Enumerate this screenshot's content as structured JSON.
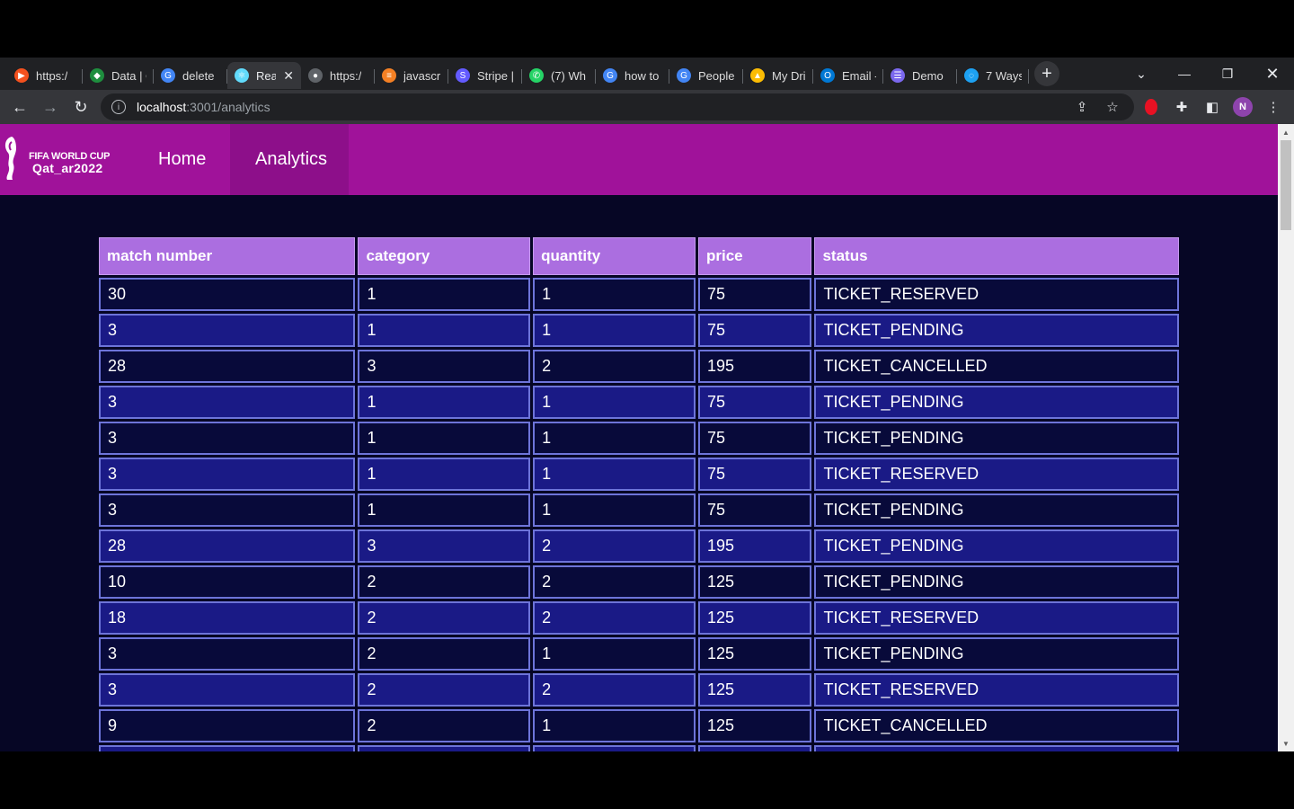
{
  "browser": {
    "tabs": [
      {
        "title": "https:/",
        "color": "#f4511e",
        "glyph": "▶"
      },
      {
        "title": "Data | C",
        "color": "#1e8e3e",
        "glyph": "◆"
      },
      {
        "title": "delete",
        "color": "#4285f4",
        "glyph": "G"
      },
      {
        "title": "Rea",
        "color": "#61dafb",
        "glyph": "⚛",
        "active": true
      },
      {
        "title": "https:/",
        "color": "#5f6368",
        "glyph": "●"
      },
      {
        "title": "javascr",
        "color": "#f48024",
        "glyph": "≡"
      },
      {
        "title": "Stripe |",
        "color": "#635bff",
        "glyph": "S"
      },
      {
        "title": "(7) Wh",
        "color": "#25d366",
        "glyph": "✆"
      },
      {
        "title": "how to",
        "color": "#4285f4",
        "glyph": "G"
      },
      {
        "title": "People",
        "color": "#4285f4",
        "glyph": "G"
      },
      {
        "title": "My Dri",
        "color": "#fbbc04",
        "glyph": "▲"
      },
      {
        "title": "Email -",
        "color": "#0078d4",
        "glyph": "O"
      },
      {
        "title": "Demo",
        "color": "#7b68ee",
        "glyph": "☰"
      },
      {
        "title": "7 Ways",
        "color": "#1da1f2",
        "glyph": "◌"
      }
    ],
    "address": {
      "host": "localhost",
      "path": ":3001/analytics"
    },
    "profile_initial": "N"
  },
  "app": {
    "logo": {
      "line1": "FIFA WORLD CUP",
      "line2": "Qat_ar2022"
    },
    "nav": {
      "home": "Home",
      "analytics": "Analytics"
    }
  },
  "table": {
    "columns": [
      "match number",
      "category",
      "quantity",
      "price",
      "status"
    ],
    "rows": [
      [
        "30",
        "1",
        "1",
        "75",
        "TICKET_RESERVED"
      ],
      [
        "3",
        "1",
        "1",
        "75",
        "TICKET_PENDING"
      ],
      [
        "28",
        "3",
        "2",
        "195",
        "TICKET_CANCELLED"
      ],
      [
        "3",
        "1",
        "1",
        "75",
        "TICKET_PENDING"
      ],
      [
        "3",
        "1",
        "1",
        "75",
        "TICKET_PENDING"
      ],
      [
        "3",
        "1",
        "1",
        "75",
        "TICKET_RESERVED"
      ],
      [
        "3",
        "1",
        "1",
        "75",
        "TICKET_PENDING"
      ],
      [
        "28",
        "3",
        "2",
        "195",
        "TICKET_PENDING"
      ],
      [
        "10",
        "2",
        "2",
        "125",
        "TICKET_PENDING"
      ],
      [
        "18",
        "2",
        "2",
        "125",
        "TICKET_RESERVED"
      ],
      [
        "3",
        "2",
        "1",
        "125",
        "TICKET_PENDING"
      ],
      [
        "3",
        "2",
        "2",
        "125",
        "TICKET_RESERVED"
      ],
      [
        "9",
        "2",
        "1",
        "125",
        "TICKET_CANCELLED"
      ],
      [
        "",
        "",
        "",
        "",
        ""
      ]
    ]
  }
}
